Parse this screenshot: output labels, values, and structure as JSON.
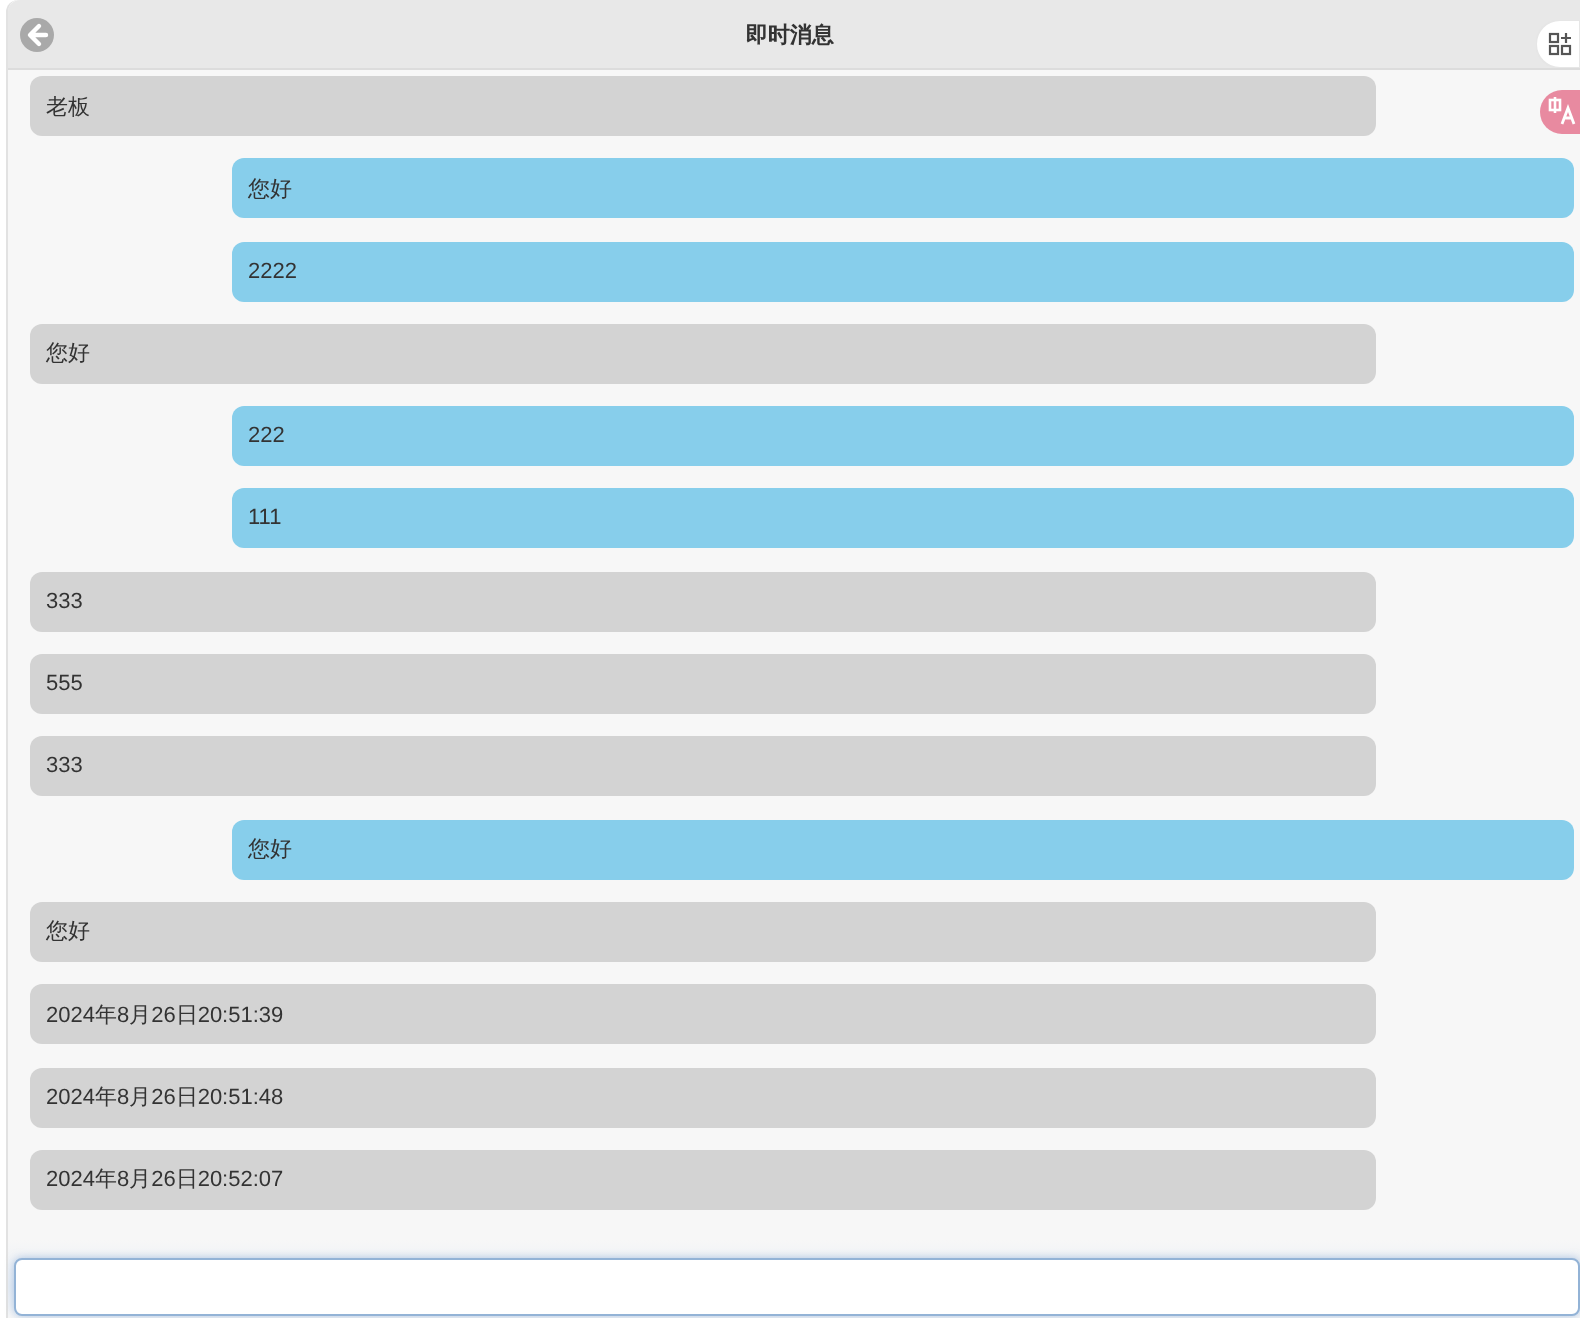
{
  "header": {
    "title": "即时消息"
  },
  "messages": [
    {
      "kind": "incoming",
      "text": "老板"
    },
    {
      "kind": "outgoing",
      "text": "您好"
    },
    {
      "kind": "outgoing",
      "text": "2222"
    },
    {
      "kind": "incoming",
      "text": "您好"
    },
    {
      "kind": "outgoing",
      "text": "222"
    },
    {
      "kind": "outgoing",
      "text": "111"
    },
    {
      "kind": "incoming",
      "text": "333"
    },
    {
      "kind": "incoming",
      "text": "555"
    },
    {
      "kind": "incoming",
      "text": "333"
    },
    {
      "kind": "outgoing",
      "text": "您好"
    },
    {
      "kind": "incoming",
      "text": "您好"
    },
    {
      "kind": "incoming",
      "text": "2024年8月26日20:51:39"
    },
    {
      "kind": "incoming",
      "text": "2024年8月26日20:51:48"
    },
    {
      "kind": "incoming",
      "text": "2024年8月26日20:52:07"
    }
  ]
}
